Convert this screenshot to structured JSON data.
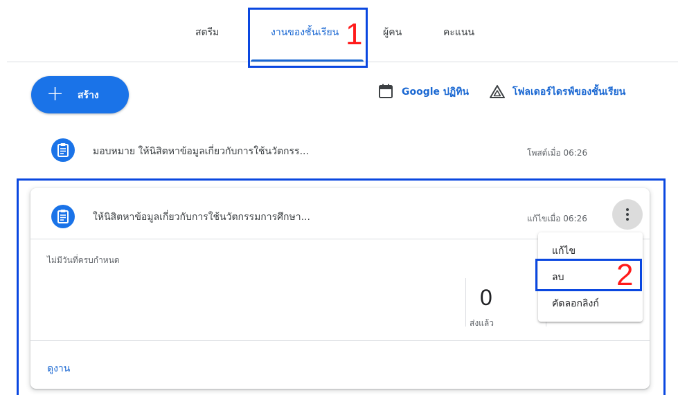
{
  "tabs": [
    {
      "label": "สตรีม",
      "active": false
    },
    {
      "label": "งานของชั้นเรียน",
      "active": true
    },
    {
      "label": "ผู้คน",
      "active": false
    },
    {
      "label": "คะแนน",
      "active": false
    }
  ],
  "annotations": {
    "n1": "1",
    "n2": "2"
  },
  "toolbar": {
    "create_label": "สร้าง",
    "calendar_label": "Google ปฏิทิน",
    "drive_label": "โฟลเดอร์ไดรฟ์ของชั้นเรียน"
  },
  "assignment_row": {
    "title": "มอบหมาย ให้นิสิตหาข้อมูลเกี่ยวกับการใช้นวัตกรร...",
    "meta": "โพสต์เมื่อ 06:26"
  },
  "card": {
    "title": "ให้นิสิตหาข้อมูลเกี่ยวกับการใช้นวัตกรรมการศึกษา...",
    "meta": "แก้ไขเมื่อ 06:26",
    "due": "ไม่มีวันที่ครบกำหนด",
    "stat_value": "0",
    "stat_label": "ส่งแล้ว",
    "view_label": "ดูงาน"
  },
  "menu": {
    "items": [
      "แก้ไข",
      "ลบ",
      "คัดลอกลิงก์"
    ]
  },
  "colors": {
    "accent": "#1a73e8",
    "annotation_box": "#0a47e0",
    "annotation_number": "#ff1a1a"
  }
}
